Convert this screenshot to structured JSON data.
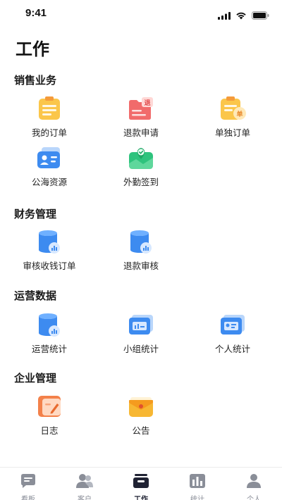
{
  "status_bar": {
    "time": "9:41"
  },
  "page": {
    "title": "工作"
  },
  "sections": {
    "sales": {
      "title": "销售业务",
      "items": [
        {
          "label": "我的订单",
          "icon": "order-clipboard-icon"
        },
        {
          "label": "退款申请",
          "icon": "refund-folder-icon"
        },
        {
          "label": "单独订单",
          "icon": "single-order-icon"
        },
        {
          "label": "公海资源",
          "icon": "contact-card-icon"
        },
        {
          "label": "外勤签到",
          "icon": "map-checkin-icon"
        }
      ]
    },
    "finance": {
      "title": "财务管理",
      "items": [
        {
          "label": "审核收钱订单",
          "icon": "database-chart-icon"
        },
        {
          "label": "退款审核",
          "icon": "database-chart-icon"
        }
      ]
    },
    "operations": {
      "title": "运营数据",
      "items": [
        {
          "label": "运营统计",
          "icon": "database-chart-icon"
        },
        {
          "label": "小组统计",
          "icon": "stats-card-icon"
        },
        {
          "label": "个人统计",
          "icon": "id-card-icon"
        }
      ]
    },
    "enterprise": {
      "title": "企业管理",
      "items": [
        {
          "label": "日志",
          "icon": "log-pen-icon"
        },
        {
          "label": "公告",
          "icon": "announcement-envelope-icon"
        }
      ]
    }
  },
  "tabbar": {
    "active": "工作",
    "tabs": [
      {
        "label": "看板",
        "icon": "chat-board-icon"
      },
      {
        "label": "客户",
        "icon": "customers-icon"
      },
      {
        "label": "工作",
        "icon": "work-tray-icon"
      },
      {
        "label": "统计",
        "icon": "bar-stats-icon"
      },
      {
        "label": "个人",
        "icon": "person-icon"
      }
    ]
  },
  "colors": {
    "yellow": "#fbc64a",
    "red": "#f16b6b",
    "blue": "#3d8bf0",
    "green": "#2ec37d",
    "orange": "#f3814a",
    "tab_active": "#1f2233",
    "tab_inactive": "#8a8e98"
  }
}
